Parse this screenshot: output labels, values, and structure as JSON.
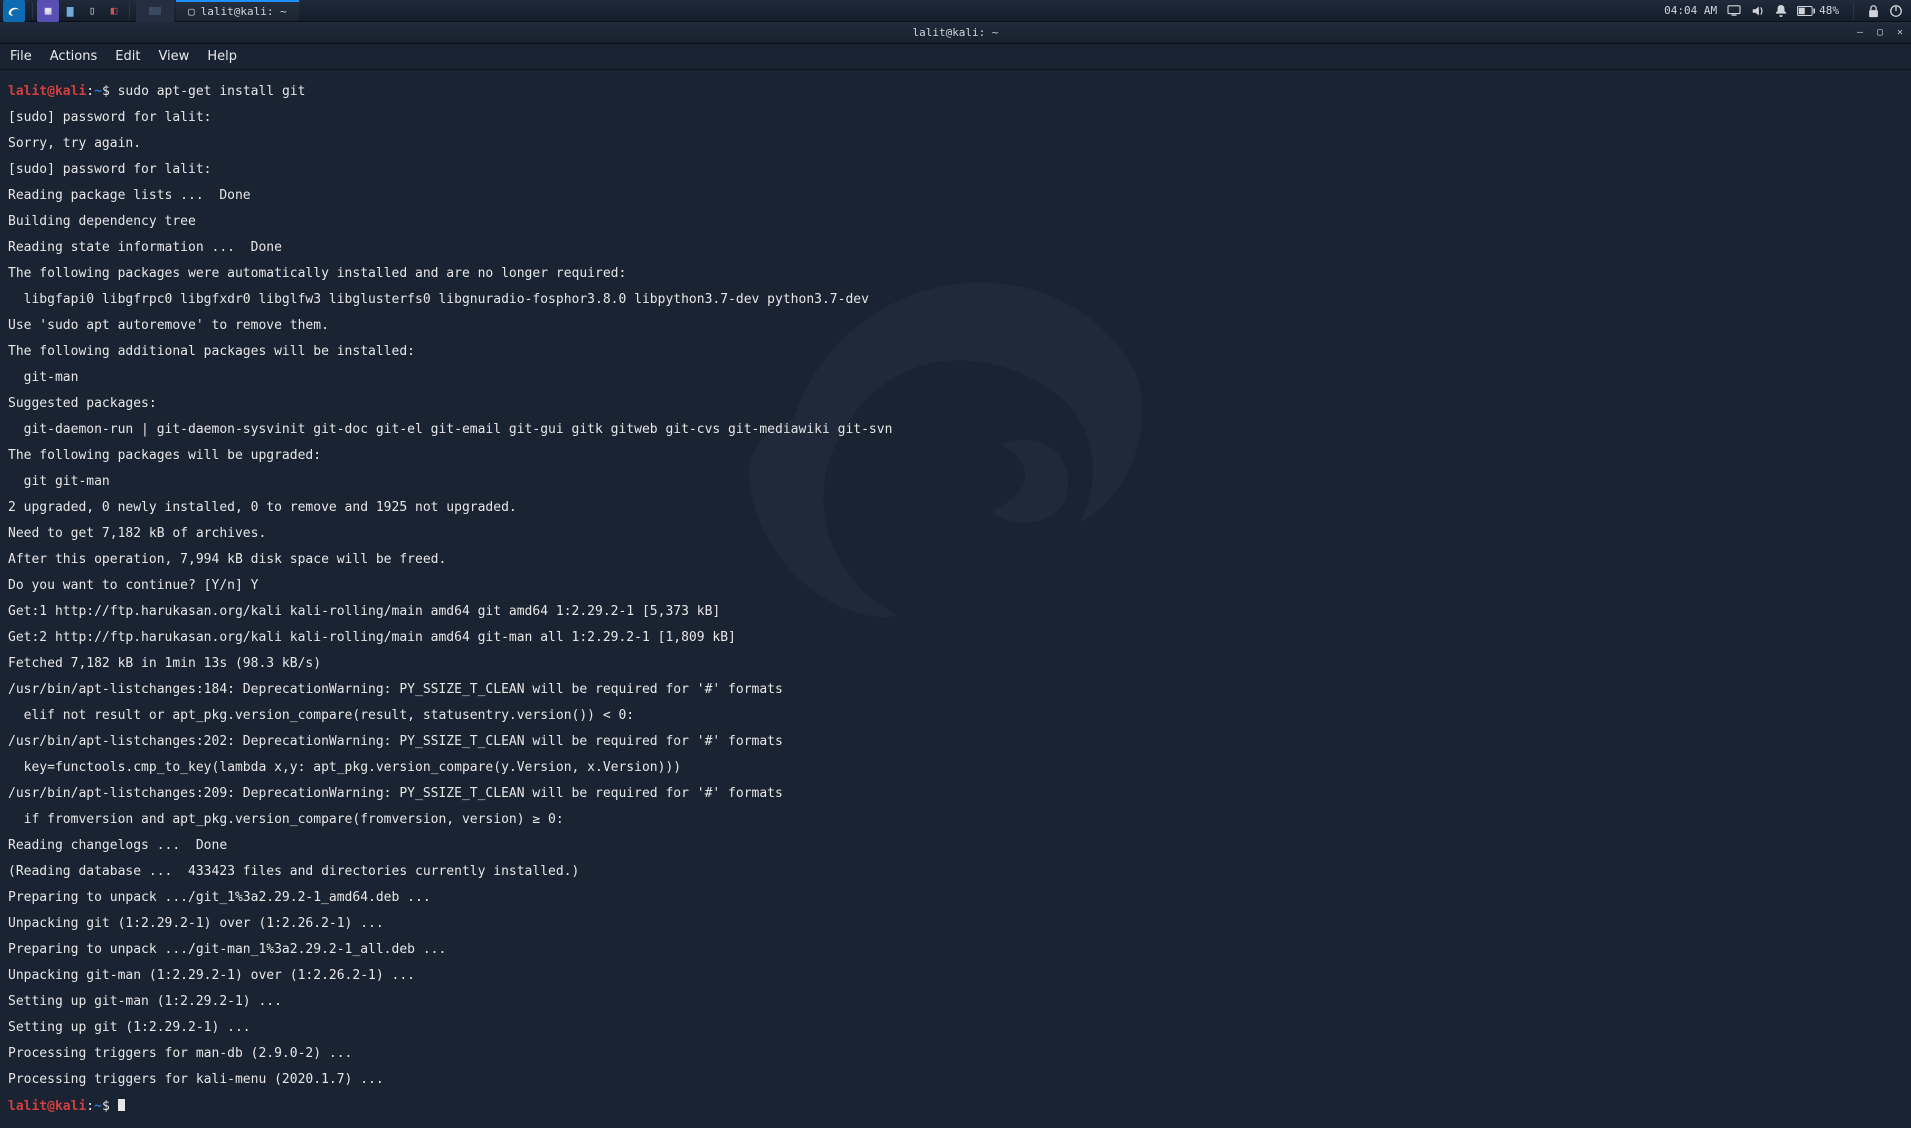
{
  "panel": {
    "taskbar_item_label": "lalit@kali: ~",
    "time": "04:04 AM",
    "battery": "48%"
  },
  "window": {
    "title": "lalit@kali: ~"
  },
  "menubar": {
    "file": "File",
    "actions": "Actions",
    "edit": "Edit",
    "view": "View",
    "help": "Help"
  },
  "prompt": {
    "user_host": "lalit@kali",
    "colon": ":",
    "path": "~",
    "dollar": "$"
  },
  "term": {
    "cmd1": " sudo apt-get install git",
    "l01": "[sudo] password for lalit: ",
    "l02": "Sorry, try again.",
    "l03": "[sudo] password for lalit: ",
    "l04": "Reading package lists ...  Done",
    "l05": "Building dependency tree       ",
    "l06": "Reading state information ...  Done",
    "l07": "The following packages were automatically installed and are no longer required:",
    "l08": "  libgfapi0 libgfrpc0 libgfxdr0 libglfw3 libglusterfs0 libgnuradio-fosphor3.8.0 libpython3.7-dev python3.7-dev",
    "l09": "Use 'sudo apt autoremove' to remove them.",
    "l10": "The following additional packages will be installed:",
    "l11": "  git-man",
    "l12": "Suggested packages:",
    "l13": "  git-daemon-run | git-daemon-sysvinit git-doc git-el git-email git-gui gitk gitweb git-cvs git-mediawiki git-svn",
    "l14": "The following packages will be upgraded:",
    "l15": "  git git-man",
    "l16": "2 upgraded, 0 newly installed, 0 to remove and 1925 not upgraded.",
    "l17": "Need to get 7,182 kB of archives.",
    "l18": "After this operation, 7,994 kB disk space will be freed.",
    "l19": "Do you want to continue? [Y/n] Y",
    "l20": "Get:1 http://ftp.harukasan.org/kali kali-rolling/main amd64 git amd64 1:2.29.2-1 [5,373 kB]",
    "l21": "Get:2 http://ftp.harukasan.org/kali kali-rolling/main amd64 git-man all 1:2.29.2-1 [1,809 kB]",
    "l22": "Fetched 7,182 kB in 1min 13s (98.3 kB/s)",
    "l23": "/usr/bin/apt-listchanges:184: DeprecationWarning: PY_SSIZE_T_CLEAN will be required for '#' formats",
    "l24": "  elif not result or apt_pkg.version_compare(result, statusentry.version()) < 0:",
    "l25": "/usr/bin/apt-listchanges:202: DeprecationWarning: PY_SSIZE_T_CLEAN will be required for '#' formats",
    "l26": "  key=functools.cmp_to_key(lambda x,y: apt_pkg.version_compare(y.Version, x.Version)))",
    "l27": "/usr/bin/apt-listchanges:209: DeprecationWarning: PY_SSIZE_T_CLEAN will be required for '#' formats",
    "l28": "  if fromversion and apt_pkg.version_compare(fromversion, version) ≥ 0:",
    "l29": "Reading changelogs ...  Done",
    "l30": "(Reading database ...  433423 files and directories currently installed.)",
    "l31": "Preparing to unpack .../git_1%3a2.29.2-1_amd64.deb ... ",
    "l32": "Unpacking git (1:2.29.2-1) over (1:2.26.2-1) ... ",
    "l33": "Preparing to unpack .../git-man_1%3a2.29.2-1_all.deb ... ",
    "l34": "Unpacking git-man (1:2.29.2-1) over (1:2.26.2-1) ... ",
    "l35": "Setting up git-man (1:2.29.2-1) ... ",
    "l36": "Setting up git (1:2.29.2-1) ... ",
    "l37": "Processing triggers for man-db (2.9.0-2) ... ",
    "l38": "Processing triggers for kali-menu (2020.1.7) ... "
  }
}
